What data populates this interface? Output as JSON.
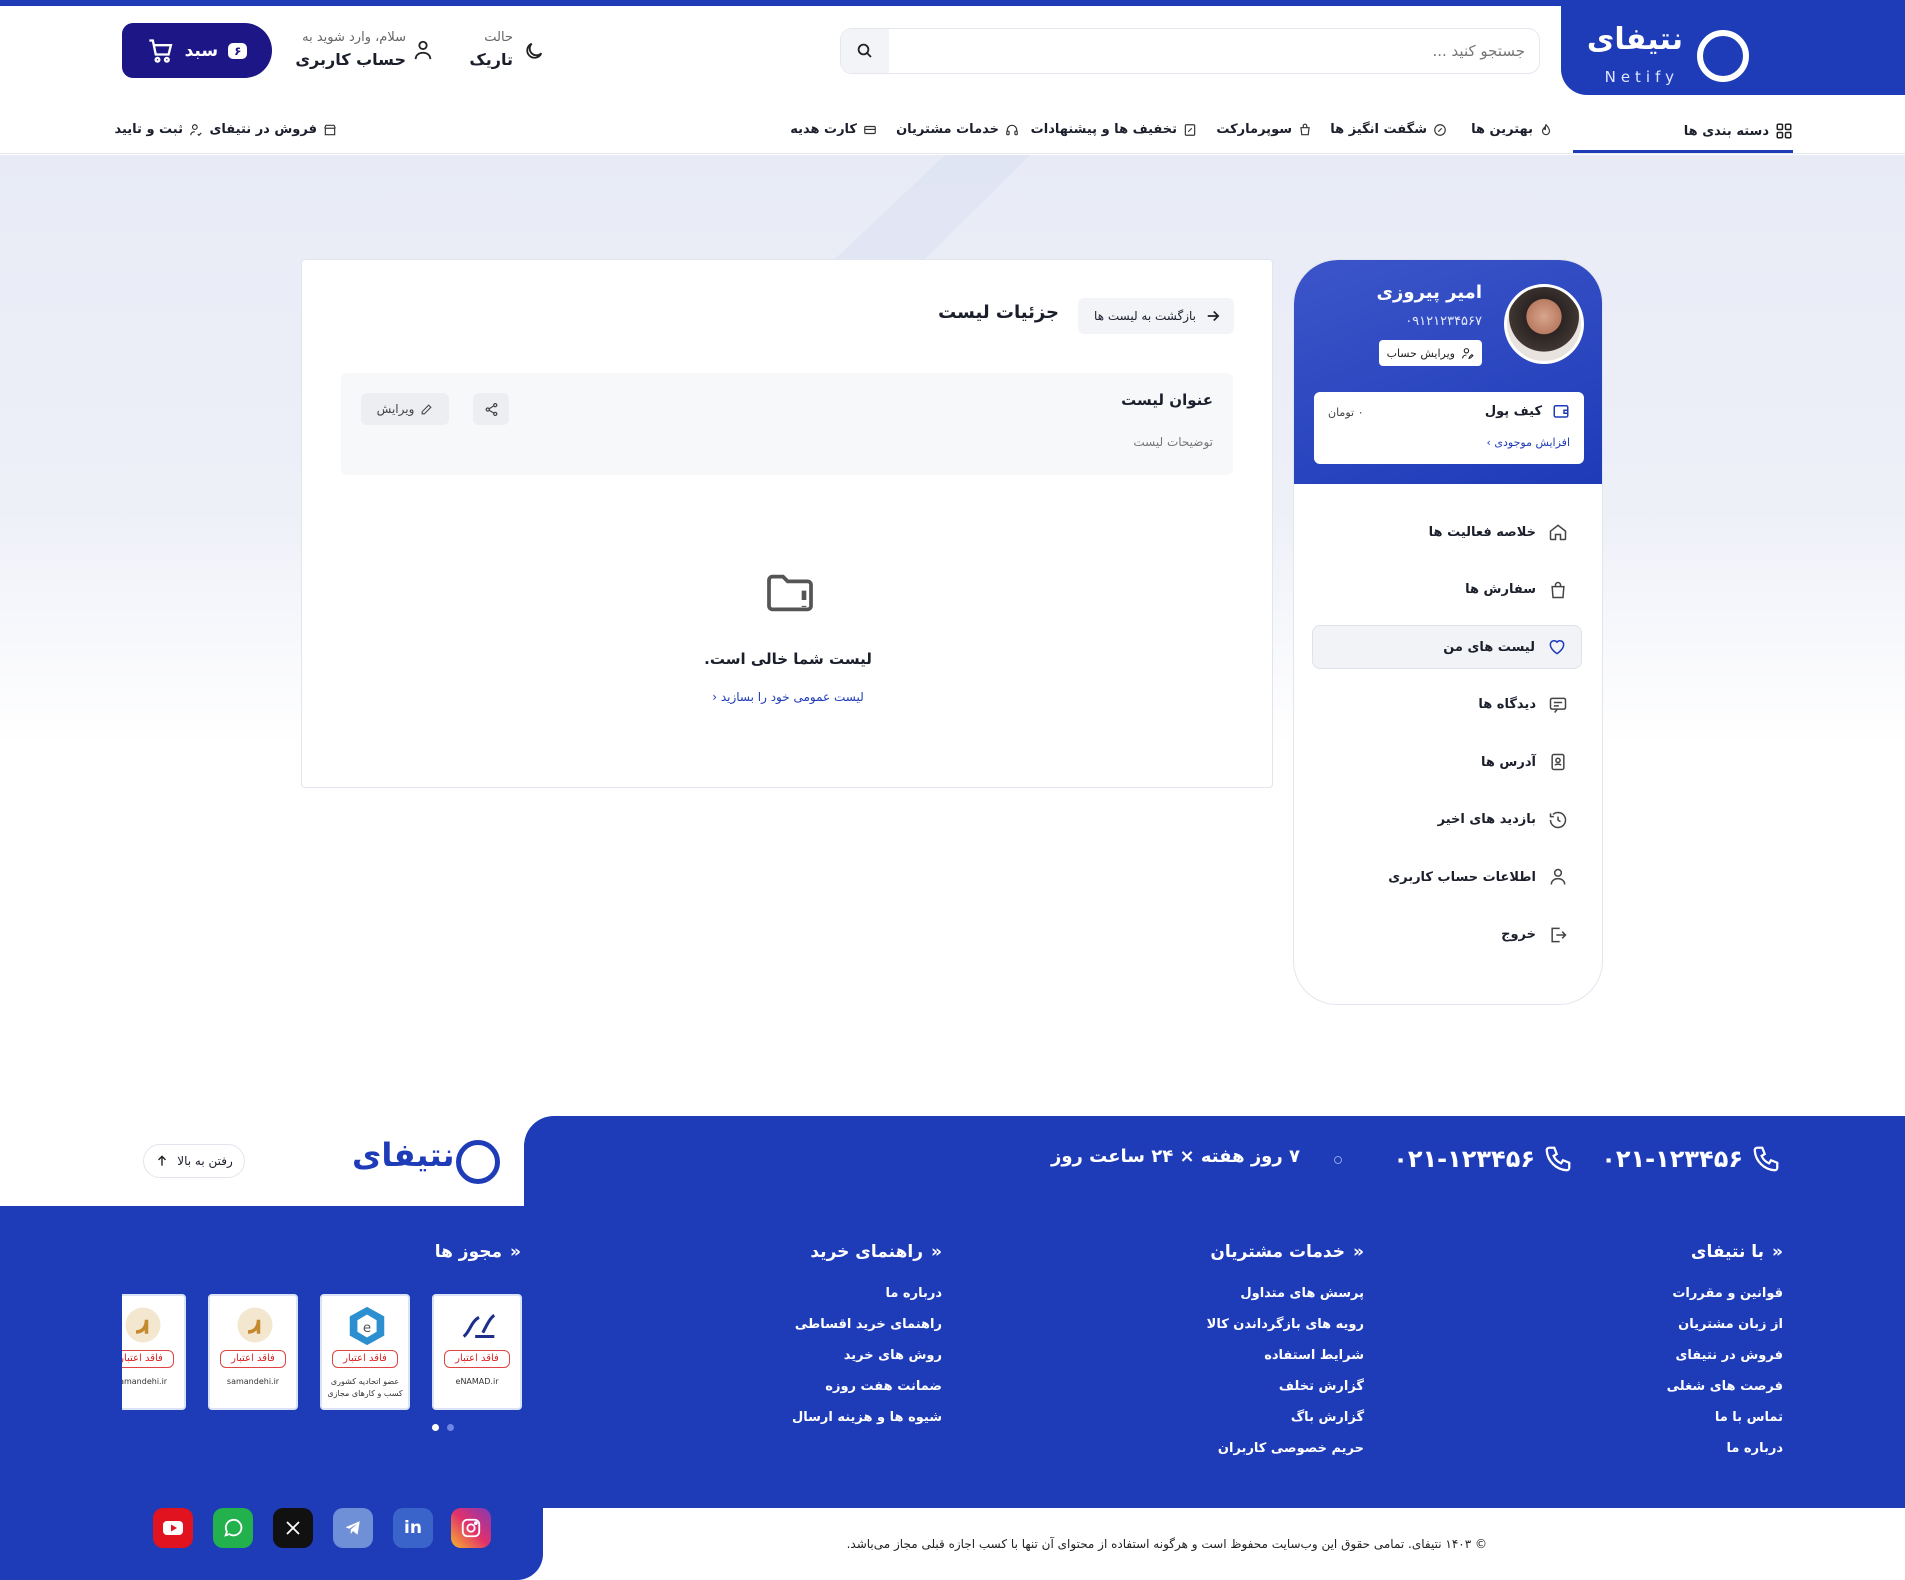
{
  "header": {
    "logo_text": "نتیفای",
    "logo_sub": "Netify",
    "search_placeholder": "جستجو کنید ...",
    "theme_small": "حالت",
    "theme_big": "تاریک",
    "account_small": "سلام، وارد شوید به",
    "account_big": "حساب کاربری",
    "cart_label": "سبد",
    "cart_count": "۶"
  },
  "nav": {
    "categories": "دسته بندی ها",
    "best": "بهترین ها",
    "amazing": "شگفت انگیز ها",
    "supermarket": "سوپرمارکت",
    "offers": "تخفیف ها و پیشنهادات",
    "services": "خدمات مشتریان",
    "gift": "کارت هدیه",
    "sell": "فروش در نتیفای",
    "register": "ثبت و تایید"
  },
  "profile": {
    "name": "امیر پیروزی",
    "phone": "۰۹۱۲۱۲۳۴۵۶۷",
    "edit_label": "ویرایش حساب",
    "wallet_title": "کیف پول",
    "wallet_value": "۰ تومان",
    "wallet_link": "افزایش موجودی"
  },
  "menu": [
    {
      "label": "خلاصه فعالیت ها",
      "icon": "home-icon"
    },
    {
      "label": "سفارش ها",
      "icon": "bag-icon"
    },
    {
      "label": "لیست های من",
      "icon": "heart-icon"
    },
    {
      "label": "دیدگاه ها",
      "icon": "comment-icon"
    },
    {
      "label": "آدرس ها",
      "icon": "address-icon"
    },
    {
      "label": "بازدید های اخیر",
      "icon": "history-icon"
    },
    {
      "label": "اطلاعات حساب کاربری",
      "icon": "user-icon"
    },
    {
      "label": "خروج",
      "icon": "logout-icon"
    }
  ],
  "main": {
    "title": "جزئیات لیست",
    "back_label": "بازگشت به لیست ها",
    "list_title": "عنوان لیست",
    "list_desc": "توضیحات لیست",
    "edit_label": "ویرایش",
    "empty_text": "لیست شما خالی است.",
    "empty_link": "لیست عمومی خود را بسازید"
  },
  "footer": {
    "phone1": "۰۲۱-۱۲۳۴۵۶",
    "phone2": "۰۲۱-۱۲۳۴۵۶",
    "hours": "۷ روز هفته × ۲۴ ساعت روز",
    "logo_text": "نتیفای",
    "totop_label": "رفتن به بالا",
    "col1_title": "با نتیفای",
    "col1": [
      "قوانین و مقررات",
      "از زبان مشتریان",
      "فروش در نتیفای",
      "فرصت های شغلی",
      "تماس با ما",
      "درباره ما"
    ],
    "col2_title": "خدمات مشتریان",
    "col2": [
      "پرسش های متداول",
      "رویه های بازگرداندن کالا",
      "شرایط استفاده",
      "گزارش تخلف",
      "گزارش باگ",
      "حریم خصوصی کاربران"
    ],
    "col3_title": "راهنمای خرید",
    "col3": [
      "درباره ما",
      "راهنمای خرید اقساطی",
      "روش های خرید",
      "ضمانت هفت روزه",
      "شیوه ها و هزینه ارسال"
    ],
    "col4_title": "مجوز ها",
    "badges": [
      {
        "label": "فاقد اعتبار",
        "sub": "eNAMAD.ir"
      },
      {
        "label": "فاقد اعتبار",
        "sub": "عضو اتحادیه کشوری کسب و کارهای مجازی"
      },
      {
        "label": "فاقد اعتبار",
        "sub": "samandehi.ir"
      },
      {
        "label": "فاقد اعتبار",
        "sub": "samandehi.ir"
      }
    ],
    "copyright": "© ۱۴۰۳ نتیفای. تمامی حقوق این وب‌سایت محفوظ است و هرگونه استفاده از محتوای آن تنها با کسب اجازه قبلی مجاز می‌باشد."
  },
  "colors": {
    "brand": "#1e3bb8",
    "cart": "#1c1687"
  }
}
